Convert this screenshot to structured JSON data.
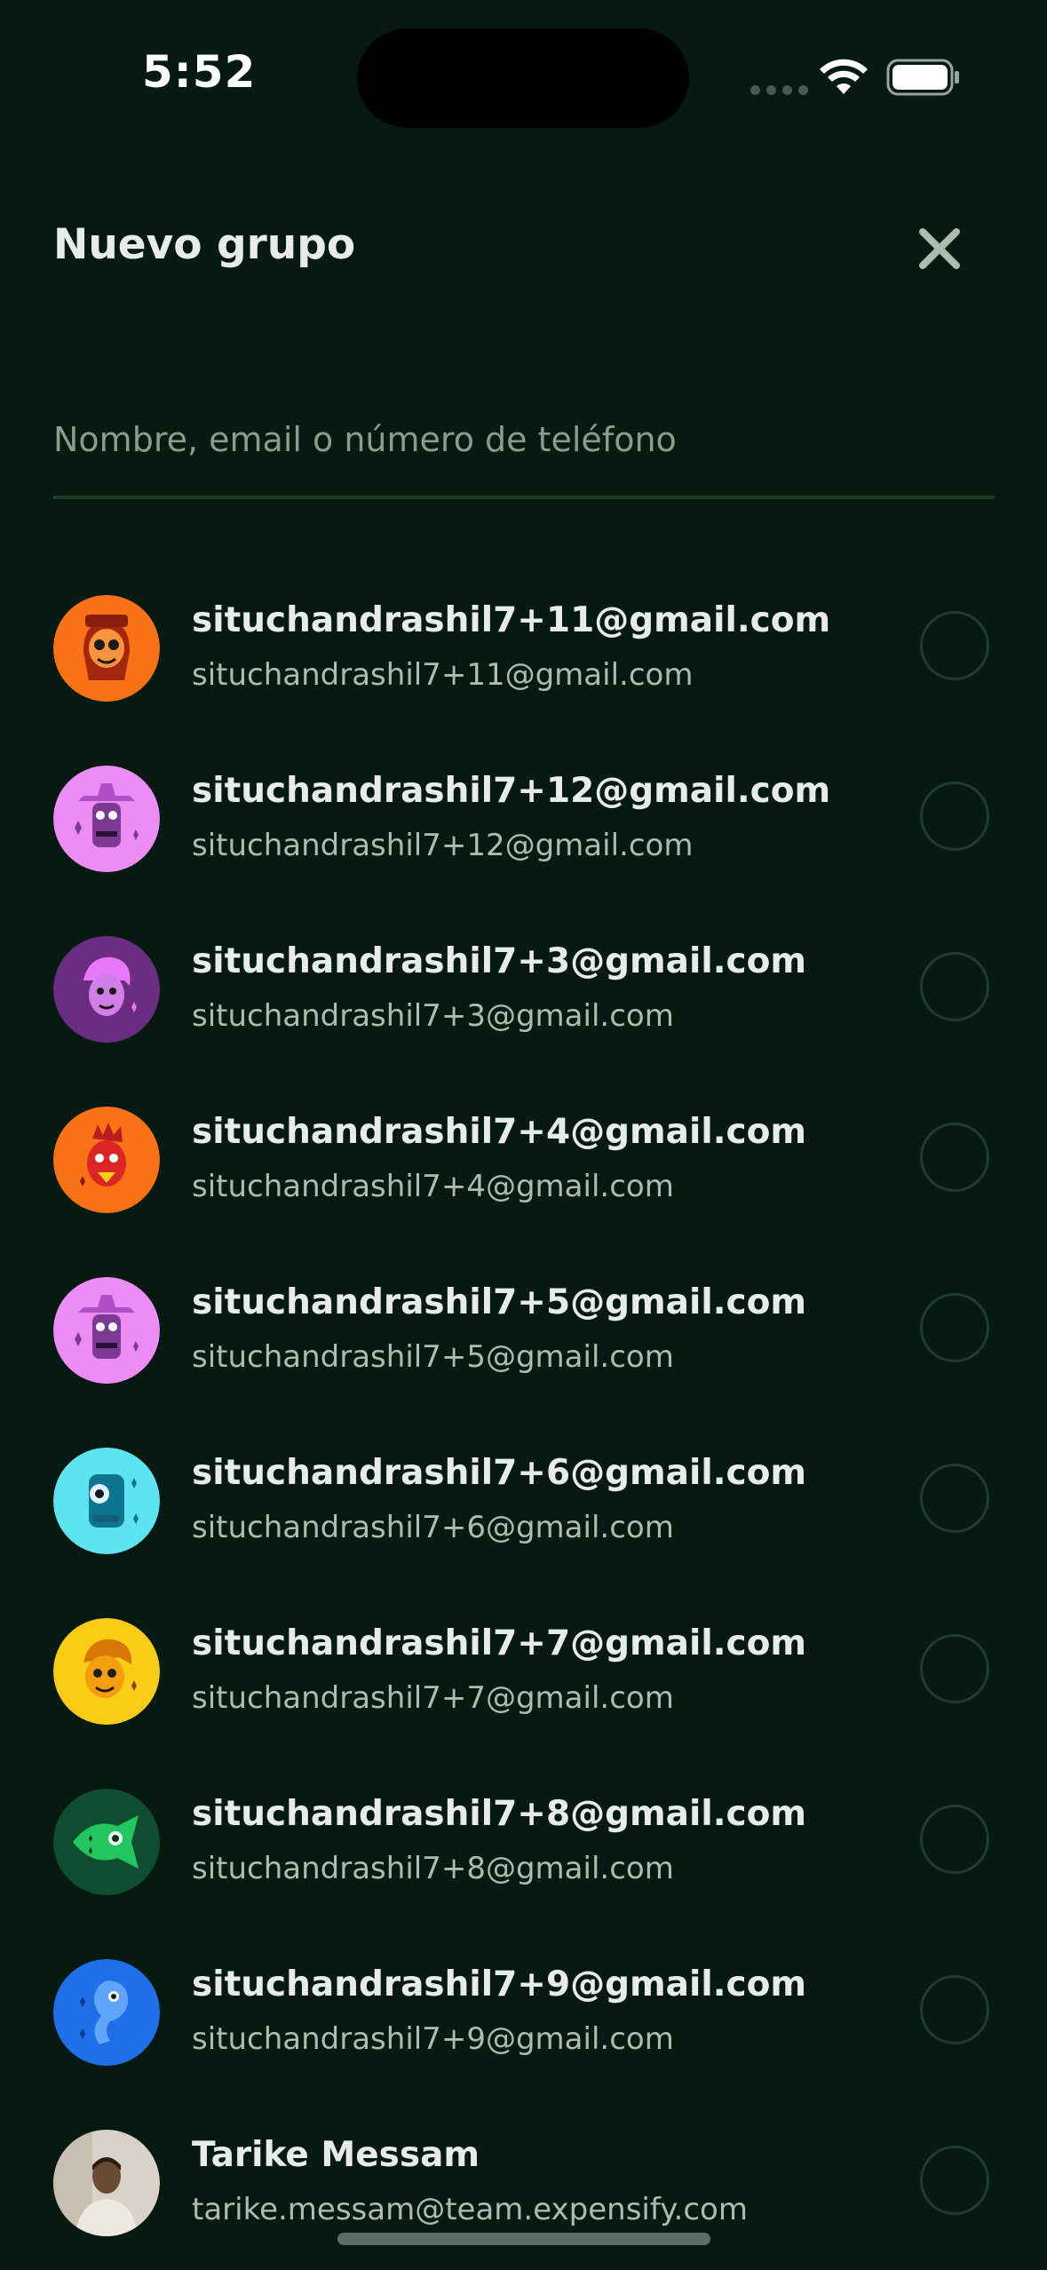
{
  "status_bar": {
    "time": "5:52"
  },
  "header": {
    "title": "Nuevo grupo",
    "close_icon": "close-icon"
  },
  "search": {
    "placeholder": "Nombre, email o número de teléfono",
    "value": ""
  },
  "contacts": [
    {
      "name": "situchandrashil7+11@gmail.com",
      "subtitle": "situchandrashil7+11@gmail.com",
      "avatar_color": "#F97316",
      "avatar_icon": "avatar-illustration-icon"
    },
    {
      "name": "situchandrashil7+12@gmail.com",
      "subtitle": "situchandrashil7+12@gmail.com",
      "avatar_color": "#EE8CF5",
      "avatar_icon": "avatar-illustration-icon"
    },
    {
      "name": "situchandrashil7+3@gmail.com",
      "subtitle": "situchandrashil7+3@gmail.com",
      "avatar_color": "#6B2D82",
      "avatar_icon": "avatar-illustration-icon"
    },
    {
      "name": "situchandrashil7+4@gmail.com",
      "subtitle": "situchandrashil7+4@gmail.com",
      "avatar_color": "#F97316",
      "avatar_icon": "avatar-illustration-icon"
    },
    {
      "name": "situchandrashil7+5@gmail.com",
      "subtitle": "situchandrashil7+5@gmail.com",
      "avatar_color": "#EE8CF5",
      "avatar_icon": "avatar-illustration-icon"
    },
    {
      "name": "situchandrashil7+6@gmail.com",
      "subtitle": "situchandrashil7+6@gmail.com",
      "avatar_color": "#5EE4F0",
      "avatar_icon": "avatar-illustration-icon"
    },
    {
      "name": "situchandrashil7+7@gmail.com",
      "subtitle": "situchandrashil7+7@gmail.com",
      "avatar_color": "#FACC15",
      "avatar_icon": "avatar-illustration-icon"
    },
    {
      "name": "situchandrashil7+8@gmail.com",
      "subtitle": "situchandrashil7+8@gmail.com",
      "avatar_color": "#0F4D33",
      "avatar_icon": "avatar-illustration-icon"
    },
    {
      "name": "situchandrashil7+9@gmail.com",
      "subtitle": "situchandrashil7+9@gmail.com",
      "avatar_color": "#1E6FE8",
      "avatar_icon": "avatar-illustration-icon"
    },
    {
      "name": "Tarike Messam",
      "subtitle": "tarike.messam@team.expensify.com",
      "avatar_color": "#D9D2C8",
      "avatar_icon": "user-photo"
    }
  ],
  "colors": {
    "background": "#061A11",
    "text_primary": "#E7ECE9",
    "text_secondary": "#AFBBB0",
    "border": "#1C3D2F"
  }
}
